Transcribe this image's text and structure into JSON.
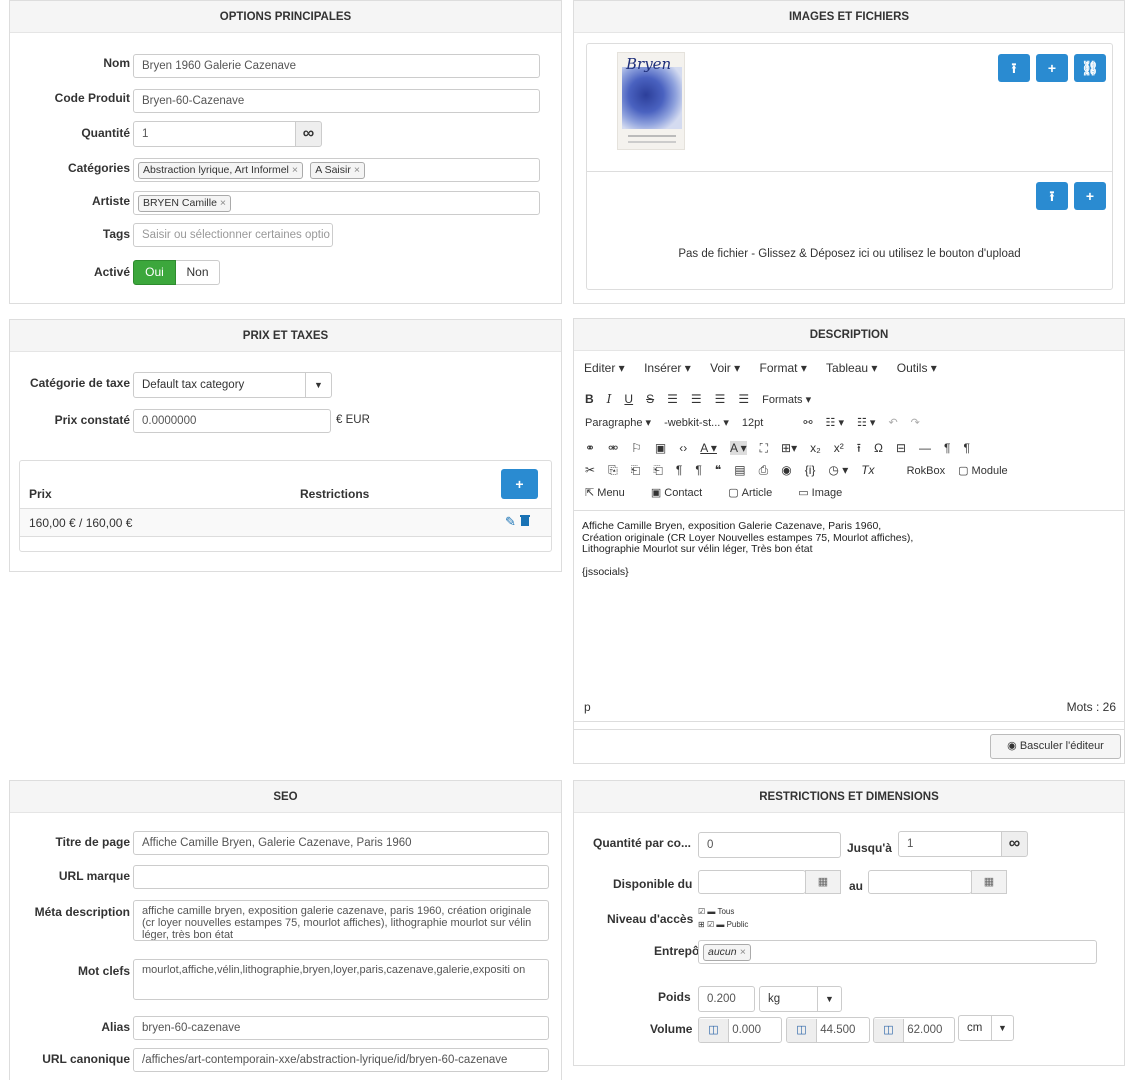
{
  "options": {
    "title": "OPTIONS PRINCIPALES",
    "nom_label": "Nom",
    "nom_value": "Bryen 1960 Galerie Cazenave",
    "code_label": "Code Produit",
    "code_value": "Bryen-60-Cazenave",
    "qty_label": "Quantité",
    "qty_value": "1",
    "qty_addon": "∞",
    "cat_label": "Catégories",
    "categories": [
      "Abstraction lyrique, Art Informel",
      "A Saisir"
    ],
    "artist_label": "Artiste",
    "artists": [
      "BRYEN Camille"
    ],
    "tags_label": "Tags",
    "tags_placeholder": "Saisir ou sélectionner certaines optio",
    "active_label": "Activé",
    "yes": "Oui",
    "no": "Non"
  },
  "images": {
    "title": "IMAGES ET FICHIERS",
    "thumb_text": "Bryen",
    "no_file_text": "Pas de fichier - Glissez & Déposez ici ou utilisez le bouton d'upload",
    "upload_icon": "⭱",
    "add_icon": "+",
    "link_icon": "🔗"
  },
  "prix": {
    "title": "PRIX ET TAXES",
    "taxcat_label": "Catégorie de taxe",
    "taxcat_value": "Default tax category",
    "prix_label": "Prix constaté",
    "prix_value": "0.0000000",
    "currency": "€ EUR",
    "col_prix": "Prix",
    "col_restrictions": "Restrictions",
    "row_prix": "160,00 € / 160,00 €"
  },
  "description": {
    "title": "DESCRIPTION",
    "menu": [
      "Editer ▾",
      "Insérer ▾",
      "Voir ▾",
      "Format ▾",
      "Tableau ▾",
      "Outils ▾"
    ],
    "formats": "Formats ▾",
    "paragraphe": "Paragraphe ▾",
    "font": "-webkit-st... ▾",
    "size": "12pt",
    "rokbox": "RokBox",
    "module": "Module",
    "menu_btn": "Menu",
    "contact_btn": "Contact",
    "article_btn": "Article",
    "image_btn": "Image",
    "lines": [
      "Affiche Camille Bryen, exposition Galerie Cazenave, Paris 1960,",
      "Création originale (CR Loyer Nouvelles estampes 75, Mourlot affiches),",
      "Lithographie Mourlot sur vélin léger, Très bon état",
      "{jssocials}"
    ],
    "path": "p",
    "word_count": "Mots : 26",
    "toggle": "Basculer l'éditeur"
  },
  "seo": {
    "title": "SEO",
    "page_title_label": "Titre de page",
    "page_title_value": "Affiche Camille Bryen, Galerie Cazenave, Paris 1960",
    "url_brand_label": "URL marque",
    "url_brand_value": "",
    "meta_label": "Méta description",
    "meta_value": "affiche camille bryen, exposition galerie cazenave, paris 1960, création originale (cr loyer nouvelles estampes 75, mourlot affiches), lithographie mourlot sur vélin léger, très bon état",
    "keywords_label": "Mot clefs",
    "keywords_value": "mourlot,affiche,vélin,lithographie,bryen,loyer,paris,cazenave,galerie,expositi on",
    "alias_label": "Alias",
    "alias_value": "bryen-60-cazenave",
    "canon_label": "URL canonique",
    "canon_value": "/affiches/art-contemporain-xxe/abstraction-lyrique/id/bryen-60-cazenave"
  },
  "restrictions": {
    "title": "RESTRICTIONS ET DIMENSIONS",
    "qty_label": "Quantité par co...",
    "qty_from": "0",
    "until_label": "Jusqu'à",
    "qty_to": "1",
    "inf": "∞",
    "dispo_label": "Disponible du",
    "au_label": "au",
    "access_label": "Niveau d'accès",
    "access_all": "Tous",
    "access_public": "Public",
    "warehouse_label": "Entrepôt",
    "warehouse_chip": "aucun",
    "weight_label": "Poids",
    "weight_value": "0.200",
    "weight_unit": "kg",
    "volume_label": "Volume",
    "vol1": "0.000",
    "vol2": "44.500",
    "vol3": "62.000",
    "vol_unit": "cm"
  }
}
